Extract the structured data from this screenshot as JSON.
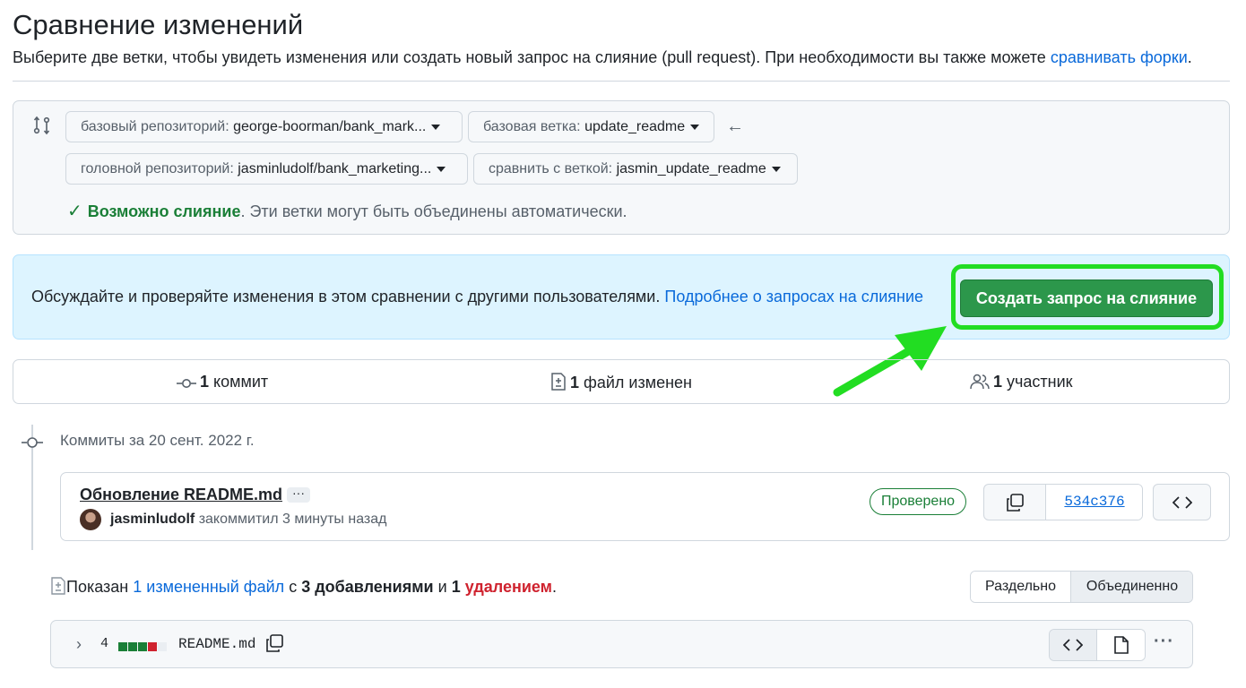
{
  "header": {
    "title": "Сравнение изменений",
    "subtitle_prefix": "Выберите две ветки, чтобы увидеть изменения или создать новый запрос на слияние (pull request). При необходимости вы также можете ",
    "subtitle_link": "сравнивать форки",
    "subtitle_suffix": "."
  },
  "range": {
    "base_repo_label": "базовый репозиторий:",
    "base_repo_value": "george-boorman/bank_mark...",
    "base_branch_label": "базовая ветка:",
    "base_branch_value": "update_readme",
    "head_repo_label": "головной репозиторий:",
    "head_repo_value": "jasminludolf/bank_marketing...",
    "compare_label": "сравнить с веткой:",
    "compare_value": "jasmin_update_readme",
    "merge_ok": "Возможно слияние",
    "merge_rest": ". Эти ветки могут быть объединены автоматически."
  },
  "flash": {
    "text": "Обсуждайте и проверяйте изменения в этом сравнении с другими пользователями.",
    "link": "Подробнее о запросах на слияние",
    "button": "Создать запрос на слияние"
  },
  "stats": {
    "commits_count": "1",
    "commits_label": "коммит",
    "files_count": "1",
    "files_label": "файл изменен",
    "contributors_count": "1",
    "contributors_label": "участник"
  },
  "commits": {
    "date_heading": "Коммиты за 20 сент. 2022 г.",
    "items": [
      {
        "message": "Обновление README.md",
        "ellipsis": "···",
        "author": "jasminludolf",
        "meta": "закоммитил 3 минуты назад",
        "badge": "Проверено",
        "sha": "534c376"
      }
    ]
  },
  "diff": {
    "shown": "Показан",
    "files_link": "1 измененный файл",
    "with": "с",
    "additions": "3 добавлениями",
    "and": "и",
    "deletions_count": "1",
    "deletions": "удалением",
    "end": ".",
    "split_label": "Раздельно",
    "unified_label": "Объединенно",
    "file": {
      "count": "4",
      "name": "README.md",
      "diffstat": [
        "#1a7f37",
        "#1a7f37",
        "#1a7f37",
        "#cf222e",
        "#eaeef2"
      ]
    }
  },
  "colors": {
    "accent": "#0969da",
    "success": "#1a7f37",
    "danger": "#cf222e",
    "cta": "#2c974b",
    "annotation": "#22dd22"
  }
}
